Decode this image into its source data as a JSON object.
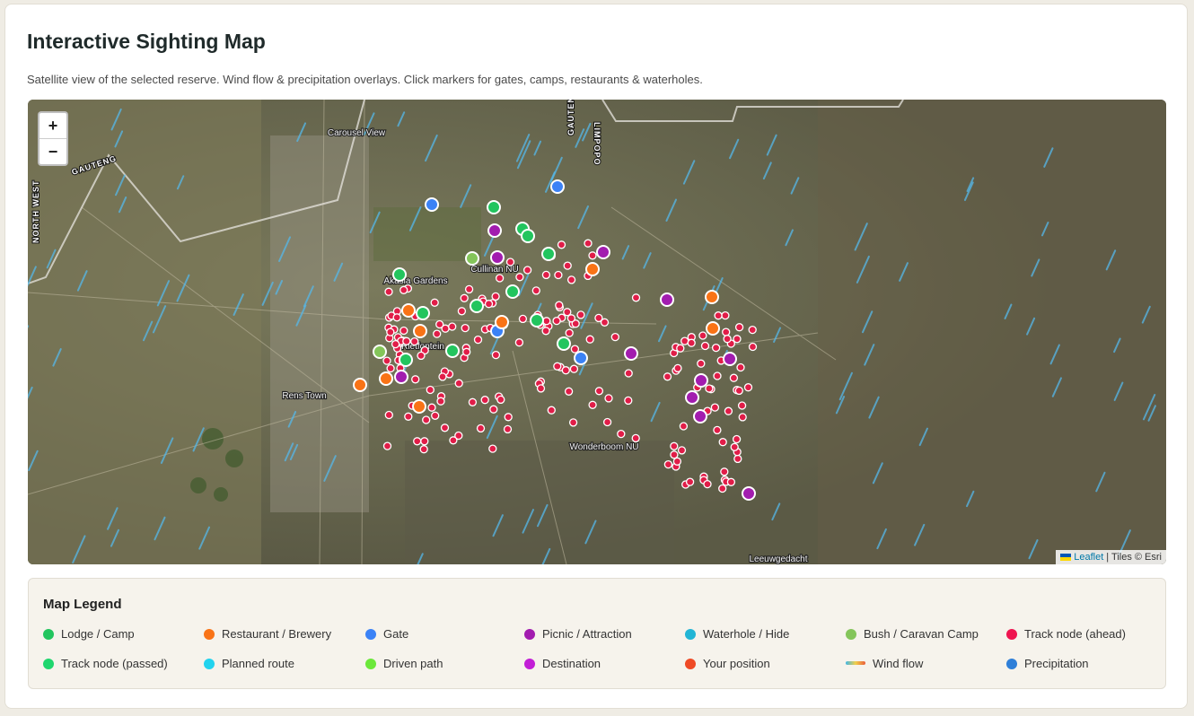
{
  "header": {
    "title": "Interactive Sighting Map",
    "subtitle": "Satellite view of the selected reserve. Wind flow & precipitation overlays. Click markers for gates, camps, restaurants & waterholes."
  },
  "map": {
    "zoom_in_label": "+",
    "zoom_out_label": "−",
    "attribution": {
      "leaflet": "Leaflet",
      "tiles": " | Tiles © Esri"
    },
    "place_labels": [
      "Carousel View",
      "Akasia Gardens",
      "Rens Town",
      "Cullinan NU",
      "Rietfontein",
      "Wonderboom NU",
      "Leeuwgedacht"
    ],
    "road_labels": [
      "NORTH WEST",
      "GAUTENG",
      "LIMPOPO",
      "GAUTENG"
    ]
  },
  "legend": {
    "title": "Map Legend",
    "items": [
      {
        "label": "Lodge / Camp",
        "color": "#22c55e",
        "kind": "dot"
      },
      {
        "label": "Restaurant / Brewery",
        "color": "#f97316",
        "kind": "dot"
      },
      {
        "label": "Gate",
        "color": "#3b82f6",
        "kind": "dot"
      },
      {
        "label": "Picnic / Attraction",
        "color": "#a21caf",
        "kind": "dot"
      },
      {
        "label": "Waterhole / Hide",
        "color": "#22b5d5",
        "kind": "dot"
      },
      {
        "label": "Bush / Caravan Camp",
        "color": "#84c55a",
        "kind": "dot"
      },
      {
        "label": "Track node (ahead)",
        "color": "#ef1550",
        "kind": "dot"
      },
      {
        "label": "Track node (passed)",
        "color": "#1fd66e",
        "kind": "dot"
      },
      {
        "label": "Planned route",
        "color": "#22d3ee",
        "kind": "dot"
      },
      {
        "label": "Driven path",
        "color": "#6be83a",
        "kind": "dot"
      },
      {
        "label": "Destination",
        "color": "#c21ed6",
        "kind": "dot"
      },
      {
        "label": "Your position",
        "color": "#ef4a25",
        "kind": "dot"
      },
      {
        "label": "Wind flow",
        "color": "#3fb6e6",
        "kind": "bar"
      },
      {
        "label": "Precipitation",
        "color": "#2f7fd8",
        "kind": "dot"
      }
    ]
  }
}
